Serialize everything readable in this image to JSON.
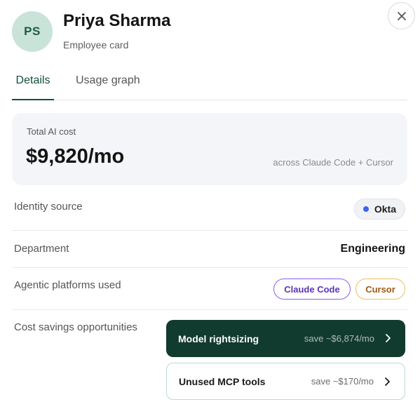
{
  "header": {
    "avatar_initials": "PS",
    "name": "Priya Sharma",
    "subtitle": "Employee card"
  },
  "tabs": [
    {
      "label": "Details",
      "active": true
    },
    {
      "label": "Usage graph",
      "active": false
    }
  ],
  "cost": {
    "label": "Total AI cost",
    "value": "$9,820/mo",
    "note": "across Claude Code + Cursor"
  },
  "identity": {
    "label": "Identity source",
    "value": "Okta"
  },
  "department": {
    "label": "Department",
    "value": "Engineering"
  },
  "platforms": {
    "label": "Agentic platforms used",
    "items": [
      "Claude Code",
      "Cursor"
    ]
  },
  "savings": {
    "label": "Cost savings opportunities",
    "items": [
      {
        "title": "Model rightsizing",
        "save": "save ~$6,874/mo"
      },
      {
        "title": "Unused MCP tools",
        "save": "save ~$170/mo"
      }
    ]
  },
  "colors": {
    "brand_dark_green": "#123b2f",
    "tab_active": "#134e3b",
    "okta_dot": "#3e64f0",
    "claude_border": "#8b5cf6",
    "cursor_border": "#e8c15a"
  },
  "icons": {
    "close": "close-icon",
    "chevron": "chevron-right-icon"
  }
}
